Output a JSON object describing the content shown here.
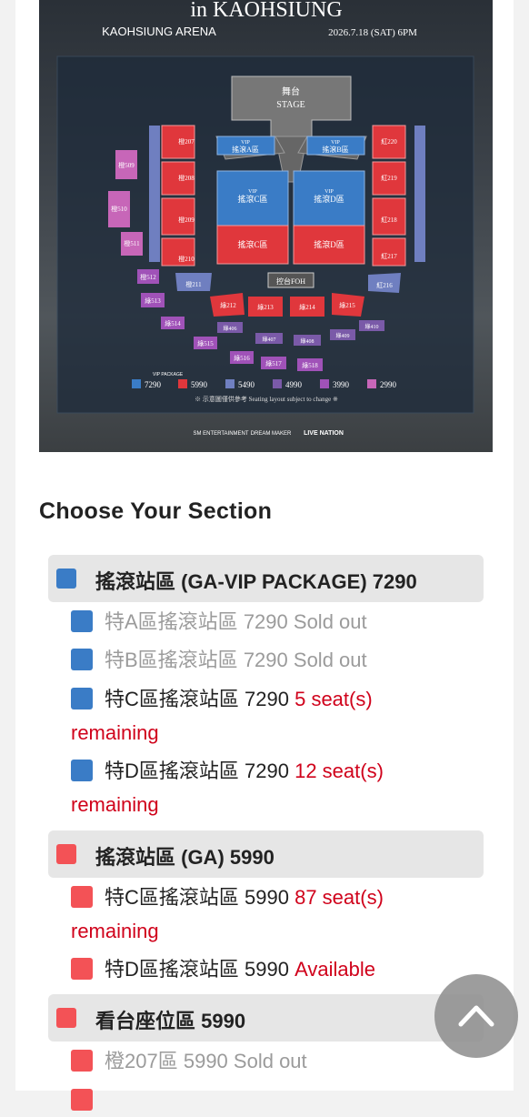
{
  "banner": {
    "title_partial": "in KAOHSIUNG",
    "venue": "KAOHSIUNG ARENA",
    "date": "2026.7.18 (SAT) 6PM",
    "stage_cn": "舞台",
    "stage_en": "STAGE",
    "vip_label": "VIP",
    "zone_a_vip": "搖滾A區",
    "zone_b_vip": "搖滾B區",
    "zone_c_vip": "搖滾C區",
    "zone_d_vip": "搖滾D區",
    "zone_c": "搖滾C區",
    "zone_d": "搖滾D區",
    "foh": "控台FOH",
    "legend_vip_note": "VIP PACKAGE",
    "legend": [
      {
        "price": "7290",
        "color": "#3a7cc6"
      },
      {
        "price": "5990",
        "color": "#e0373c"
      },
      {
        "price": "5490",
        "color": "#6f7fc0"
      },
      {
        "price": "4990",
        "color": "#7a5aa8"
      },
      {
        "price": "3990",
        "color": "#a052b8"
      },
      {
        "price": "2990",
        "color": "#c766b8"
      }
    ],
    "notice": "※ 示意圖僅供參考 Seating layout subject to change ※",
    "sponsors": [
      "SM ENTERTAINMENT",
      "DREAM MAKER",
      "LIVE NATION"
    ],
    "sections_left": [
      "橙207",
      "橙208",
      "橙209",
      "橙210",
      "橙211"
    ],
    "sections_right": [
      "紅220",
      "紅219",
      "紅218",
      "紅217",
      "紅216"
    ],
    "sections_far_left": [
      "橙509",
      "橙510",
      "橙511",
      "橙512",
      "綠513",
      "綠514",
      "綠515",
      "綠516",
      "綠517",
      "綠518"
    ],
    "sections_front": [
      "綠212",
      "綠213",
      "綠214",
      "綠215"
    ],
    "sections_lower": [
      "綠406",
      "綠407",
      "綠408",
      "綠409",
      "綠410"
    ]
  },
  "page": {
    "heading": "Choose Your Section"
  },
  "groups": [
    {
      "label": "搖滾站區 (GA-VIP PACKAGE) 7290",
      "color": "#3a7cc6",
      "items": [
        {
          "name": "特A區搖滾站區",
          "price": "7290",
          "status": "Sold out"
        },
        {
          "name": "特B區搖滾站區",
          "price": "7290",
          "status": "Sold out"
        },
        {
          "name": "特C區搖滾站區",
          "price": "7290",
          "status_a": "5 seat(s)",
          "status_b": "remaining"
        },
        {
          "name": "特D區搖滾站區",
          "price": "7290",
          "status_a": "12 seat(s)",
          "status_b": "remaining"
        }
      ]
    },
    {
      "label": "搖滾站區 (GA) 5990",
      "color": "#f35256",
      "items": [
        {
          "name": "特C區搖滾站區",
          "price": "5990",
          "status_a": "87 seat(s)",
          "status_b": "remaining"
        },
        {
          "name": "特D區搖滾站區",
          "price": "5990",
          "status": "Available"
        }
      ]
    },
    {
      "label": "看台座位區 5990",
      "color": "#f35256",
      "items": [
        {
          "name": "橙207區",
          "price": "5990",
          "status": "Sold out"
        }
      ]
    }
  ],
  "colors": {
    "vip_blue": "#3a7cc6",
    "ga_red": "#f35256",
    "status_red": "#d0021b",
    "sold_out_gray": "#9b9b9b"
  },
  "icons": {
    "scroll_top": "chevron-up-icon"
  }
}
